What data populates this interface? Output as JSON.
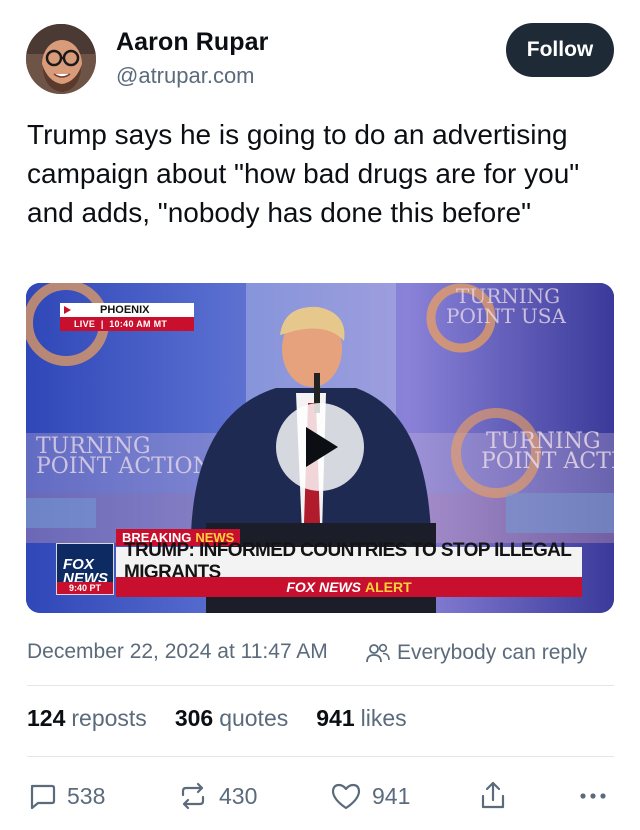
{
  "author": {
    "display_name": "Aaron Rupar",
    "handle": "@atrupar.com"
  },
  "follow_label": "Follow",
  "post_text": "Trump says he is going to do an advertising campaign about \"how bad drugs are for you\" and adds, \"nobody has done this before\"",
  "video": {
    "live_location": "PHOENIX",
    "live_label": "LIVE",
    "live_time": "10:40 AM MT",
    "breaking_label": "BREAKING",
    "breaking_news_word": "NEWS",
    "headline": "TRUMP: INFORMED COUNTRIES TO STOP ILLEGAL MIGRANTS",
    "alert_prefix": "FOX NEWS",
    "alert_word": "ALERT",
    "logo_text_1": "FOX",
    "logo_text_2": "NEWS",
    "logo_time": "9:40 PT",
    "bg_sign_1": "TURNING POINT USA",
    "bg_sign_2": "TURNING POINT ACTION"
  },
  "meta": {
    "date": "December 22, 2024 at 11:47 AM",
    "reply_setting": "Everybody can reply"
  },
  "stats": {
    "reposts_count": "124",
    "reposts_label": "reposts",
    "quotes_count": "306",
    "quotes_label": "quotes",
    "likes_count": "941",
    "likes_label": "likes"
  },
  "actions": {
    "replies": "538",
    "reposts": "430",
    "likes": "941"
  },
  "colors": {
    "follow_bg": "#1e2a36",
    "muted_text": "#5b6b7b",
    "fox_red": "#c8102e"
  },
  "icons": [
    "reply-icon",
    "repost-icon",
    "like-icon",
    "share-icon",
    "more-icon",
    "people-icon",
    "play-icon"
  ]
}
